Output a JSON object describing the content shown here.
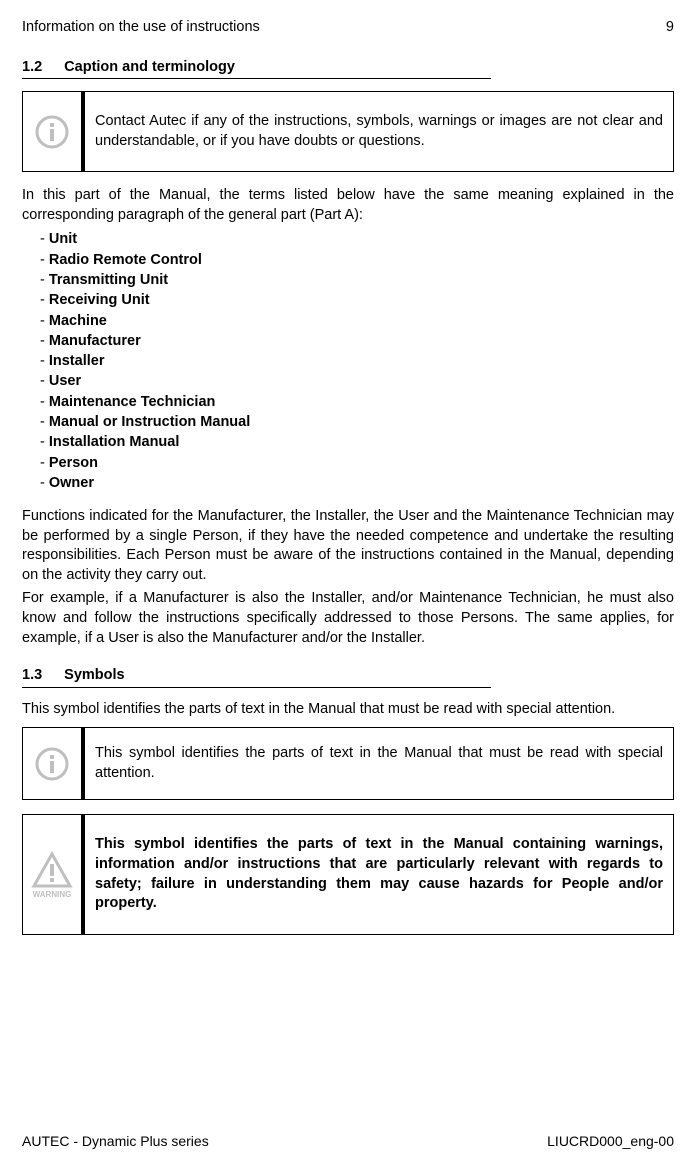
{
  "header": {
    "title": "Information on the use of instructions",
    "page": "9"
  },
  "sec12": {
    "num": "1.2",
    "title": "Caption and terminology"
  },
  "infobox1": "Contact Autec if any of the instructions, symbols, warnings or images are not clear and understandable, or if you have doubts or questions.",
  "p1": "In this part of the Manual, the terms listed below have the same meaning explained in the corresponding paragraph of the general part (Part A):",
  "terms": {
    "t0": "Unit",
    "t1": "Radio Remote Control",
    "t2": "Transmitting Unit",
    "t3": "Receiving Unit",
    "t4": "Machine",
    "t5": "Manufacturer",
    "t6": "Installer",
    "t7": "User",
    "t8": "Maintenance Technician",
    "t9": "Manual or Instruction Manual",
    "t10": "Installation Manual",
    "t11": "Person",
    "t12": "Owner"
  },
  "p2": "Functions indicated for the Manufacturer, the Installer, the User and the Maintenance Technician may be performed by a single Person, if they have the needed competence and undertake the resulting responsibilities. Each Person must be aware of the instructions contained in the Manual, depending on the activity they carry out.",
  "p3": "For example, if a Manufacturer is also the Installer, and/or Maintenance Technician, he must also know and follow the instructions specifically addressed to those Persons. The same applies, for example, if a User is also the Manufacturer and/or the Installer.",
  "sec13": {
    "num": "1.3",
    "title": "Symbols"
  },
  "p4": "This symbol identifies the parts of text in the Manual that must be read with special attention.",
  "infobox2": "This symbol identifies the parts of text in the Manual that must be read with special attention.",
  "warnbox": "This symbol identifies the parts of text in the Manual containing warnings, information and/or instructions that are particularly relevant with regards to safety; failure in understanding them may cause hazards for People and/or property.",
  "warnlabel": "WARNING",
  "footer": {
    "left": "AUTEC - Dynamic Plus series",
    "right": "LIUCRD000_eng-00"
  }
}
